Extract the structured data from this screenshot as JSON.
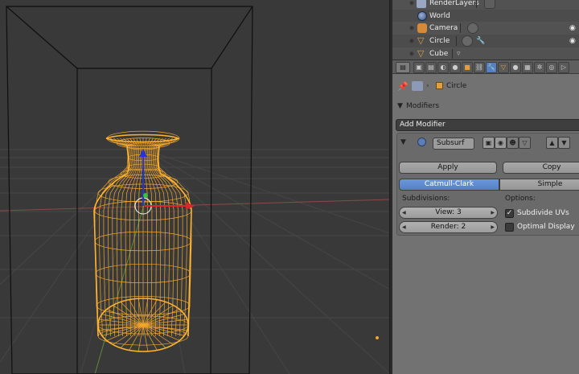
{
  "outliner": {
    "items": [
      {
        "label": "RenderLayers"
      },
      {
        "label": "World"
      },
      {
        "label": "Camera"
      },
      {
        "label": "Circle"
      },
      {
        "label": "Cube"
      }
    ]
  },
  "breadcrumb": {
    "object": "Circle"
  },
  "modifiers": {
    "section_title": "Modifiers",
    "add_modifier": "Add Modifier",
    "name": "Subsurf",
    "apply": "Apply",
    "copy": "Copy",
    "types": [
      "Catmull-Clark",
      "Simple"
    ],
    "selected_type": "Catmull-Clark",
    "subdivisions_label": "Subdivisions:",
    "view": "View: 3",
    "render": "Render: 2",
    "options_label": "Options:",
    "subdivide_uvs": {
      "label": "Subdivide UVs",
      "checked": true
    },
    "optimal_display": {
      "label": "Optimal Display",
      "checked": false
    }
  },
  "icons": [
    "pin-icon",
    "scene-icon",
    "cube-icon",
    "camera-icon",
    "cone-icon",
    "wrench-icon",
    "eye-icon",
    "eye-icon"
  ],
  "colors": {
    "wire": "#f3a72c",
    "selected_tab": "#5680c2",
    "viewport_bg": "#393939",
    "panel_bg": "#727272"
  }
}
